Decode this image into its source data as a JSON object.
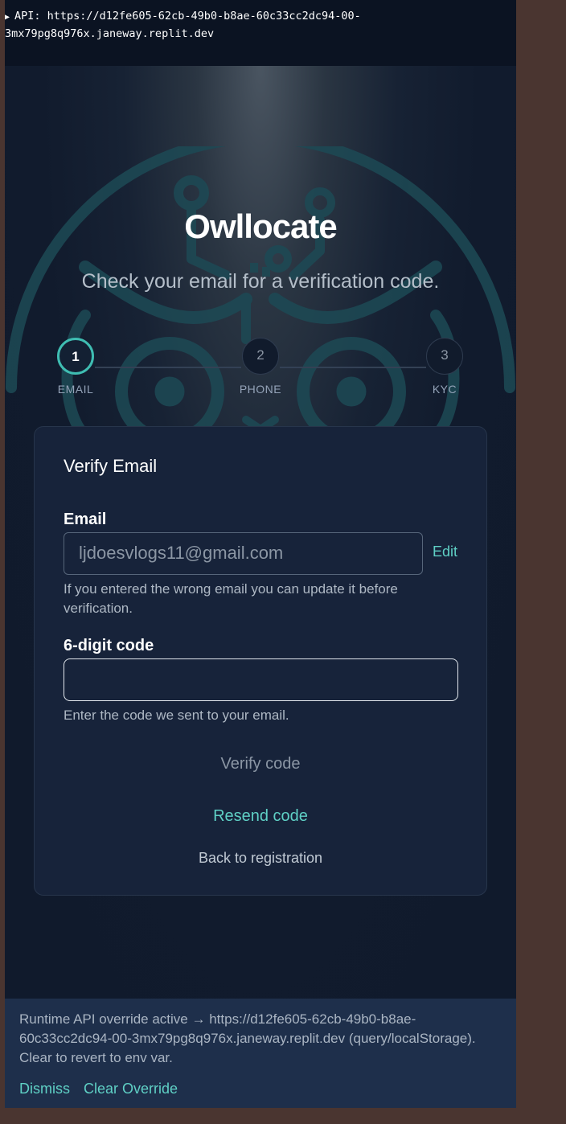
{
  "api_bar": {
    "line1": "API: https://d12fe605-62cb-49b0-b8ae-60c33cc2dc94-00-",
    "line2": "3mx79pg8q976x.janeway.replit.dev"
  },
  "brand": {
    "title": "Owllocate",
    "subtitle": "Check your email for a verification code."
  },
  "stepper": {
    "steps": [
      {
        "number": "1",
        "label": "EMAIL",
        "state": "active"
      },
      {
        "number": "2",
        "label": "PHONE",
        "state": "inactive"
      },
      {
        "number": "3",
        "label": "KYC",
        "state": "inactive"
      }
    ]
  },
  "card": {
    "title": "Verify Email",
    "email_label": "Email",
    "email_value": "ljdoesvlogs11@gmail.com",
    "edit_label": "Edit",
    "email_help": "If you entered the wrong email you can update it before verification.",
    "code_label": "6-digit code",
    "code_value": "",
    "code_help": "Enter the code we sent to your email.",
    "verify_label": "Verify code",
    "resend_label": "Resend code",
    "back_label": "Back to registration"
  },
  "override_banner": {
    "text": "Runtime API override active → https://d12fe605-62cb-49b0-b8ae-60c33cc2dc94-00-3mx79pg8q976x.janeway.replit.dev (query/localStorage). Clear to revert to env var.",
    "dismiss_label": "Dismiss",
    "clear_label": "Clear Override"
  },
  "colors": {
    "accent": "#3fbdb2",
    "link": "#5fd0c5",
    "background": "#101a2c",
    "card": "#17233a",
    "banner": "#1e2f4b"
  }
}
